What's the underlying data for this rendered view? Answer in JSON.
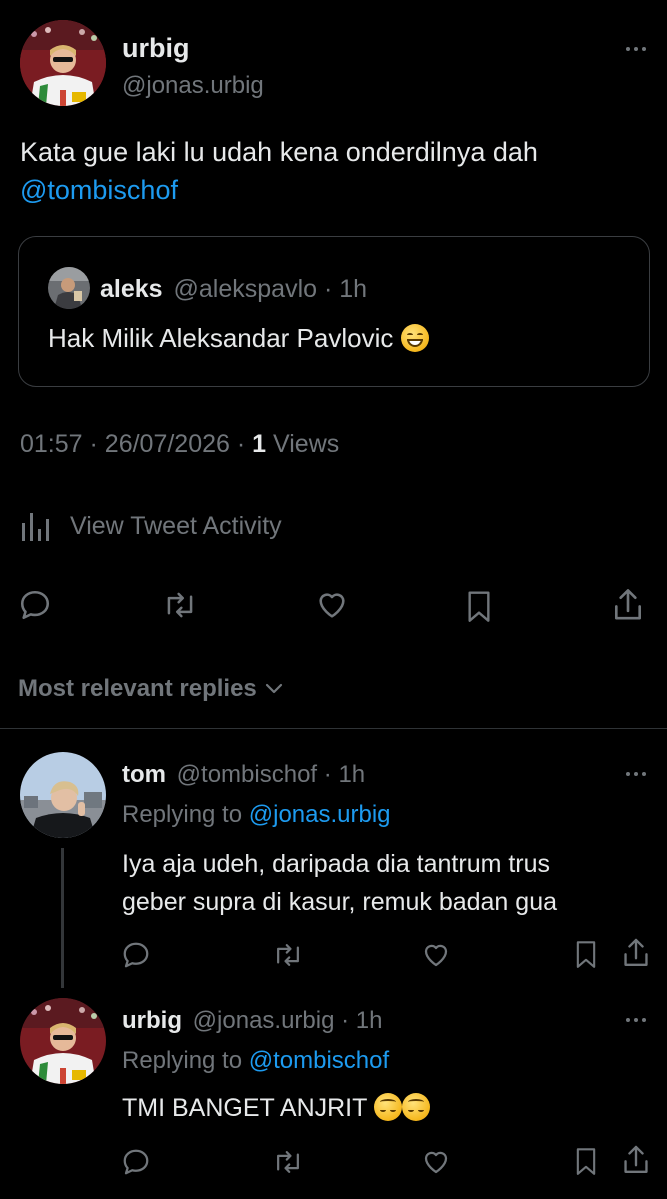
{
  "main_tweet": {
    "display_name": "urbig",
    "handle": "@jonas.urbig",
    "text": "Kata gue laki lu udah kena onderdilnya dah",
    "mention": "@tombischof",
    "quote": {
      "display_name": "aleks",
      "handle": "@alekspavlo",
      "time": "1h",
      "text": "Hak Milik Aleksandar Pavlovic"
    },
    "timestamp": "01:57",
    "date": "26/07/2026",
    "views_count": "1",
    "views_label": "Views",
    "activity_label": "View Tweet Activity"
  },
  "replies_sort_label": "Most relevant replies",
  "replies": [
    {
      "display_name": "tom",
      "handle": "@tombischof",
      "time": "1h",
      "replying_to_label": "Replying to",
      "replying_to": "@jonas.urbig",
      "text_line1": "Iya aja udeh, daripada dia tantrum trus",
      "text_line2": "geber supra di kasur, remuk badan gua"
    },
    {
      "display_name": "urbig",
      "handle": "@jonas.urbig",
      "time": "1h",
      "replying_to_label": "Replying to",
      "replying_to": "@tombischof",
      "text": "TMI BANGET ANJRIT"
    }
  ],
  "separator": "·",
  "colors": {
    "background": "#000000",
    "text": "#e7e9ea",
    "secondary": "#71767b",
    "link": "#1d9bf0",
    "divider": "#2f3336"
  }
}
